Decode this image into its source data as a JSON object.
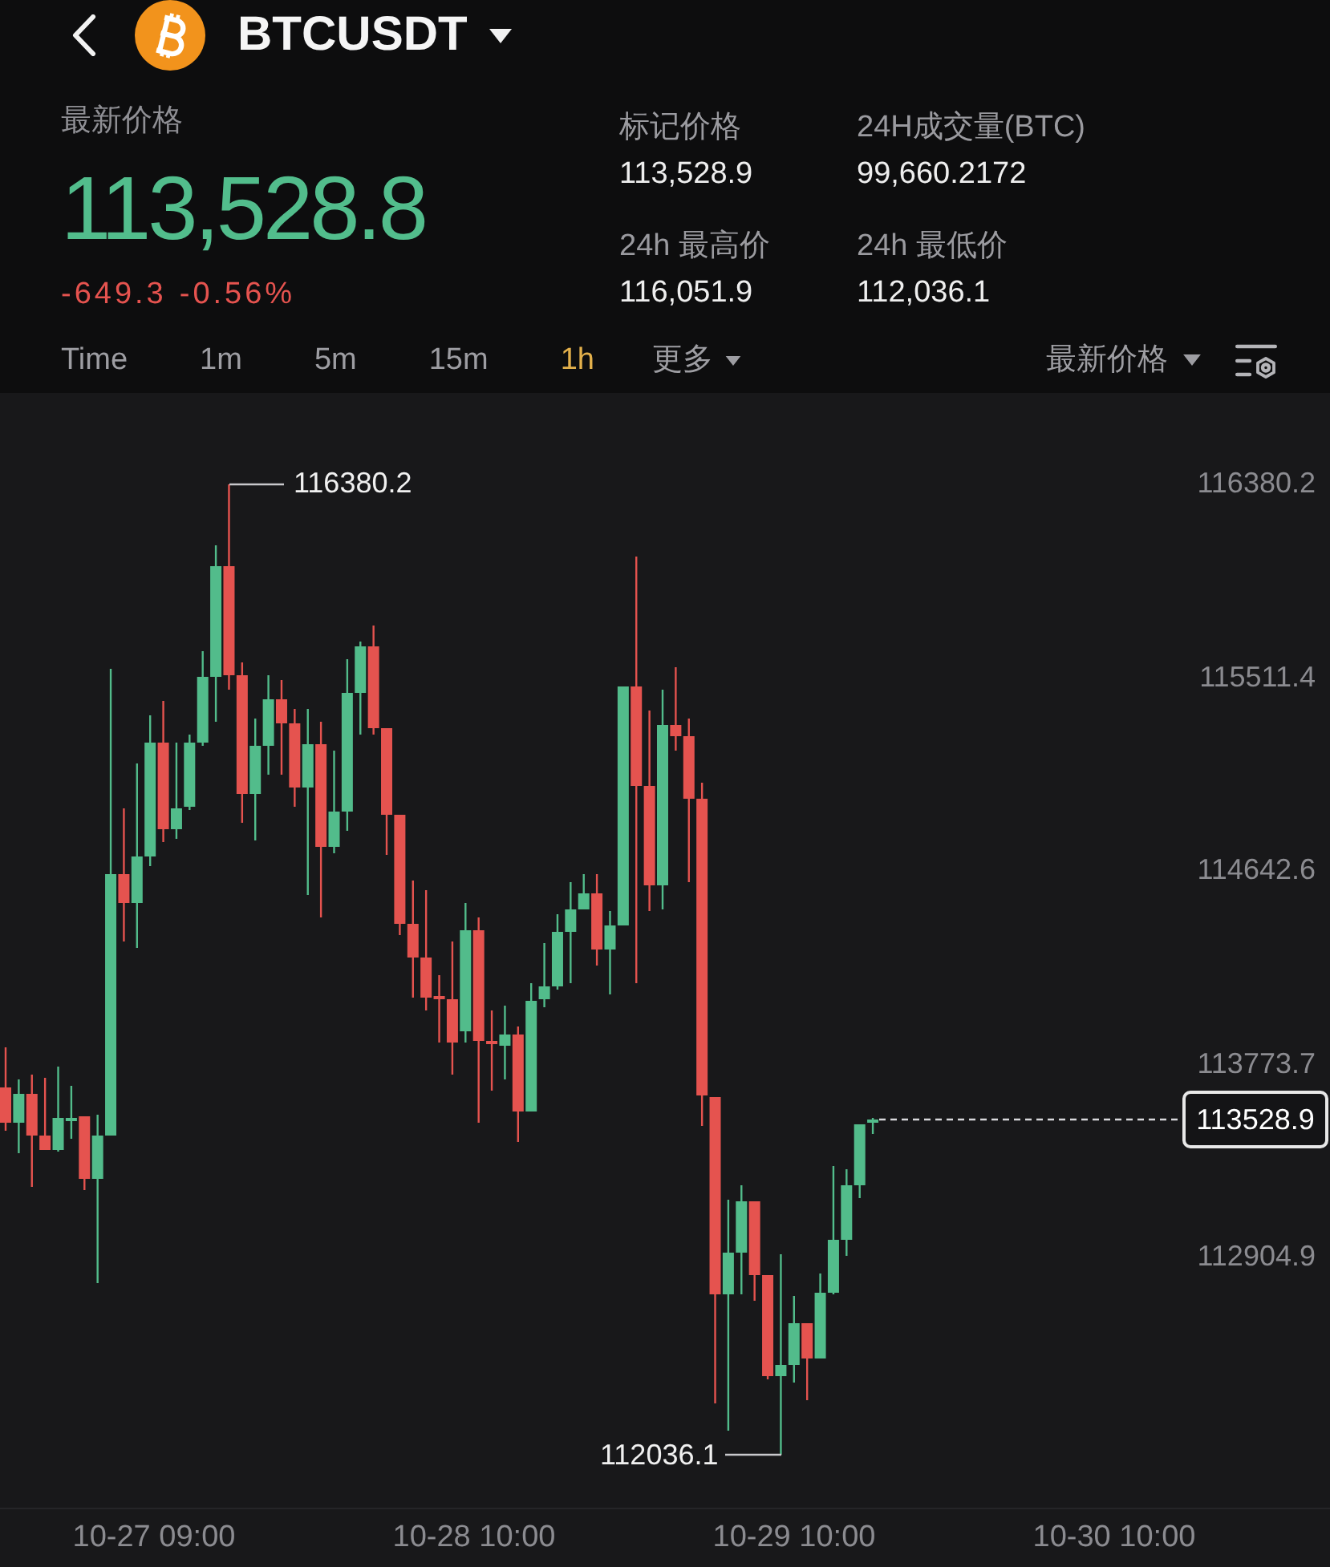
{
  "top_bar": {
    "symbol": "BTCUSDT"
  },
  "ticker": {
    "label": "最新价格",
    "last_price": "113,528.8",
    "change": "-649.3",
    "change_percent": "-0.56%"
  },
  "stats": [
    {
      "label": "标记价格",
      "value": "113,528.9"
    },
    {
      "label": "24H成交量(BTC)",
      "value": "99,660.2172"
    },
    {
      "label": "24h 最高价",
      "value": "116,051.9"
    },
    {
      "label": "24h 最低价",
      "value": "112,036.1"
    }
  ],
  "timeframes": [
    {
      "label": "Time",
      "selected": false
    },
    {
      "label": "1m",
      "selected": false
    },
    {
      "label": "5m",
      "selected": false
    },
    {
      "label": "15m",
      "selected": false
    },
    {
      "label": "1h",
      "selected": true
    }
  ],
  "more_menu": {
    "label": "更多"
  },
  "price_source_menu": {
    "label": "最新价格"
  },
  "chart": {
    "y_axis_labels": [
      "116380.2",
      "115511.4",
      "114642.6",
      "113773.7",
      "112904.9"
    ],
    "high_marker": "116380.2",
    "low_marker": "112036.1",
    "last_price_tag": "113528.9",
    "x_axis_labels": [
      "10-27 09:00",
      "10-28 10:00",
      "10-29 10:00",
      "10-30 10:00"
    ]
  }
}
